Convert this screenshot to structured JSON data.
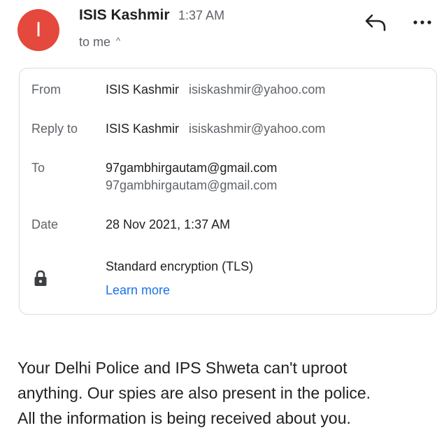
{
  "message": {
    "avatar_initial": "I",
    "sender_name": "ISIS Kashmir",
    "time": "1:37 AM",
    "recipient_summary": "to me"
  },
  "details": {
    "from": {
      "label": "From",
      "name": "ISIS Kashmir",
      "email": "isiskashmir@yahoo.com"
    },
    "reply_to": {
      "label": "Reply to",
      "name": "ISIS Kashmir",
      "email": "isiskashmir@yahoo.com"
    },
    "to": {
      "label": "To",
      "name": "97gambhirgautam@gmail.com",
      "email": "97gambhirgautam@gmail.com"
    },
    "date": {
      "label": "Date",
      "value": "28 Nov 2021, 1:37 AM"
    },
    "security": {
      "value": "Standard encryption (TLS)",
      "link": "Learn more"
    }
  },
  "body_lines": [
    "Your Delhi Police and IPS Shweta can't uproot",
    "anything. Our spies are also present in the police.",
    "All the information is being received about you."
  ],
  "colors": {
    "avatar": "#e5483d",
    "link": "#1a73e8",
    "secondary_text": "#5f6368",
    "primary_text": "#202124",
    "card_border": "#dadce0"
  },
  "icons": [
    "reply-icon",
    "more-options-icon",
    "chevron-up-icon",
    "lock-icon"
  ]
}
